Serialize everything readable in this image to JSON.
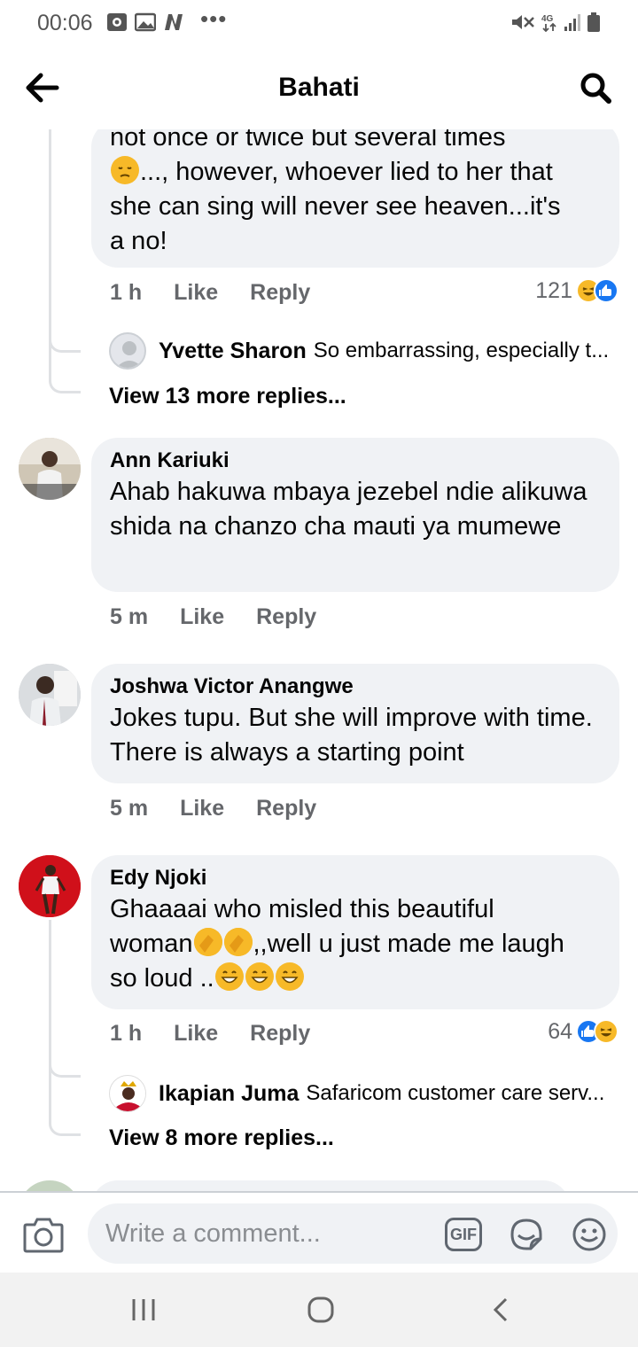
{
  "status_bar": {
    "time": "00:06",
    "dots": "•••",
    "network": "4G"
  },
  "header": {
    "title": "Bahati",
    "back_icon": "arrow-left-icon",
    "search_icon": "search-icon"
  },
  "thread_top": {
    "text_lines": [
      "not once or twice but several  times",
      "..., however, whoever lied  to her that",
      "she can sing will never see heaven...it's",
      "a no!"
    ],
    "time": "1 h",
    "like_label": "Like",
    "reply_label": "Reply",
    "reaction_count": "121",
    "reply_preview": {
      "name": "Yvette Sharon",
      "text": "So embarrassing, especially t..."
    },
    "view_more": "View 13 more replies..."
  },
  "comments": [
    {
      "author": "Ann Kariuki",
      "text": "Ahab hakuwa mbaya jezebel ndie alikuwa shida na chanzo cha mauti ya mumewe",
      "time": "5 m",
      "like_label": "Like",
      "reply_label": "Reply"
    },
    {
      "author": "Joshwa Victor Anangwe",
      "text": "Jokes tupu. But she will improve with time. There is always a starting point",
      "time": "5 m",
      "like_label": "Like",
      "reply_label": "Reply"
    },
    {
      "author": "Edy Njoki",
      "text_line1": "Ghaaaai who misled this beautiful",
      "text_line2a": "woman",
      "text_line2b": ",,well u just made me laugh",
      "text_line3": "so loud ..",
      "time": "1 h",
      "like_label": "Like",
      "reply_label": "Reply",
      "reaction_count": "64",
      "reply_preview": {
        "name": "Ikapian Juma",
        "text": "Safaricom customer care serv..."
      },
      "view_more": "View 8 more replies..."
    }
  ],
  "composer": {
    "placeholder": "Write a comment...",
    "gif_label": "GIF"
  },
  "colors": {
    "bubble": "#f0f2f5",
    "secondary_text": "#65676b",
    "like_blue": "#1877f2",
    "haha_yellow": "#f7b928"
  }
}
